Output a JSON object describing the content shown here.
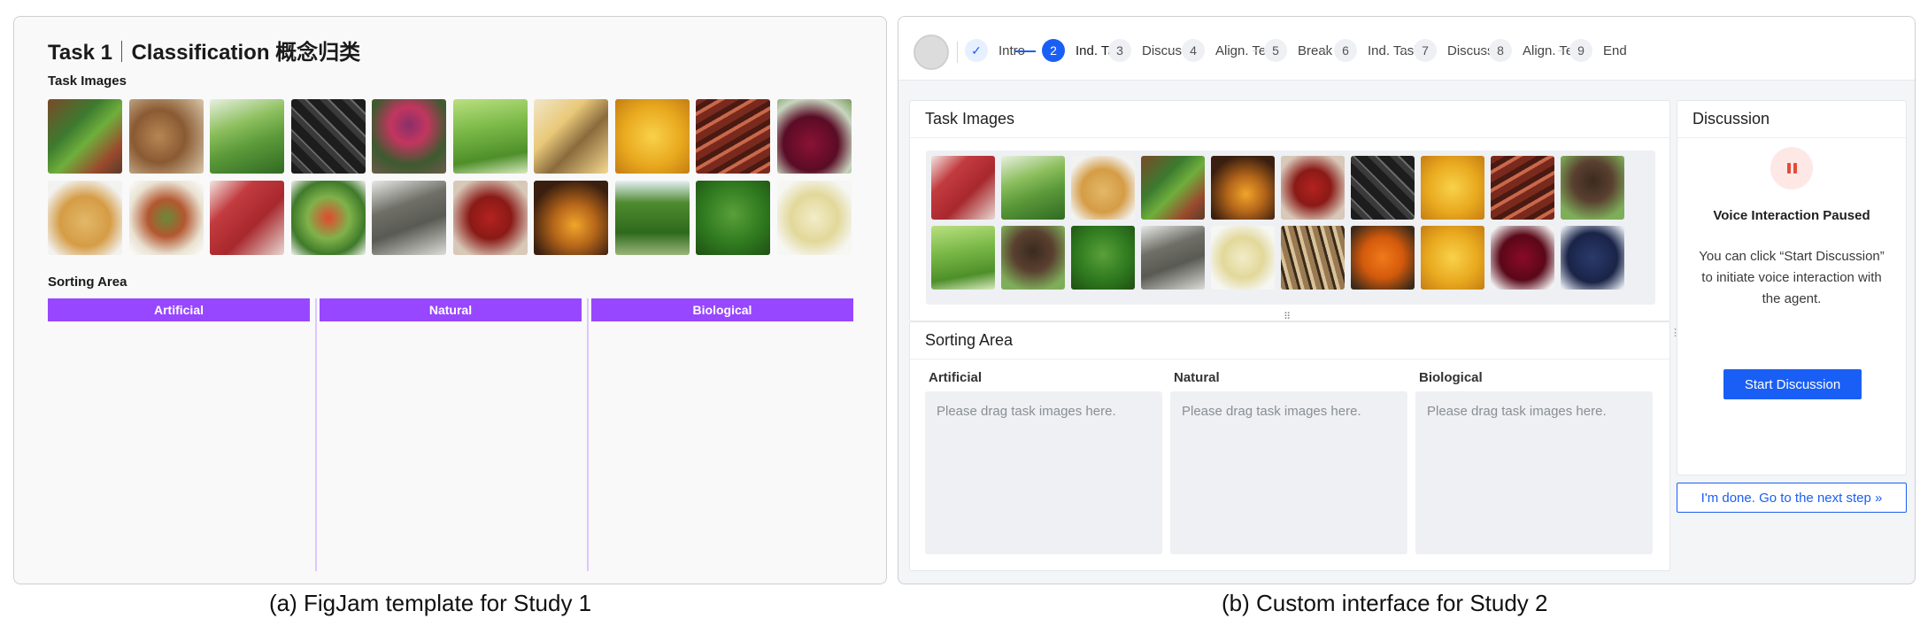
{
  "panel_a": {
    "title_task": "Task 1",
    "title_rest": "Classification 概念归类",
    "task_images_label": "Task Images",
    "images": [
      "beans",
      "nuts",
      "chives",
      "licorice",
      "flowers",
      "okra",
      "cheese",
      "corn",
      "bacon",
      "beet",
      "chickpea",
      "salad",
      "meat",
      "salad2",
      "soap",
      "pepper",
      "honey",
      "hedge",
      "broccoli",
      "paste"
    ],
    "sorting_area_label": "Sorting Area",
    "columns": [
      "Artificial",
      "Natural",
      "Biological"
    ],
    "accent": "#9747ff"
  },
  "panel_b": {
    "steps": [
      {
        "num": "✓",
        "label": "Intro",
        "state": "done"
      },
      {
        "num": "2",
        "label": "Ind. Task",
        "state": "active"
      },
      {
        "num": "3",
        "label": "Discuss",
        "state": "todo"
      },
      {
        "num": "4",
        "label": "Align. Tes",
        "state": "todo"
      },
      {
        "num": "5",
        "label": "Break",
        "state": "todo"
      },
      {
        "num": "6",
        "label": "Ind. Task",
        "state": "todo"
      },
      {
        "num": "7",
        "label": "Discuss",
        "state": "todo"
      },
      {
        "num": "8",
        "label": "Align. Tes",
        "state": "todo"
      },
      {
        "num": "9",
        "label": "End",
        "state": "todo"
      }
    ],
    "task_images_title": "Task Images",
    "images": [
      "meat",
      "chives",
      "chickpea",
      "beans",
      "honey",
      "pepper",
      "licorice",
      "corn",
      "bacon",
      "soil",
      "okra",
      "soil",
      "broccoli",
      "soap",
      "paste",
      "spice",
      "orange",
      "corn",
      "cranberry",
      "blueberry"
    ],
    "sorting_area_title": "Sorting Area",
    "columns": [
      {
        "title": "Artificial",
        "placeholder": "Please drag task images here."
      },
      {
        "title": "Natural",
        "placeholder": "Please drag task images here."
      },
      {
        "title": "Biological",
        "placeholder": "Please drag task images here."
      }
    ],
    "discussion": {
      "title": "Discussion",
      "status": "Voice Interaction Paused",
      "hint": "You can click “Start Discussion” to initiate voice interaction with the agent.",
      "start_button": "Start Discussion"
    },
    "next_button": "I'm done. Go to the next step »",
    "accent": "#1a5ff5"
  },
  "captions": {
    "a": "(a) FigJam template for Study 1",
    "b": "(b) Custom interface for Study 2"
  }
}
